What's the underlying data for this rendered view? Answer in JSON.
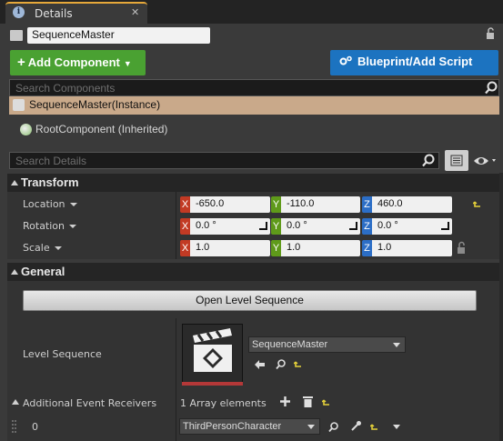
{
  "tab": {
    "title": "Details",
    "close": "✕"
  },
  "actor": {
    "name": "SequenceMaster"
  },
  "toolbar": {
    "add_component_label": "Add Component",
    "blueprint_label": "Blueprint/Add Script"
  },
  "search_components": {
    "placeholder": "Search Components"
  },
  "components": {
    "self": "SequenceMaster(Instance)",
    "root": "RootComponent (Inherited)"
  },
  "search_details": {
    "placeholder": "Search Details"
  },
  "transform": {
    "title": "Transform",
    "location": {
      "label": "Location",
      "x": "-650.0",
      "y": "-110.0",
      "z": "460.0"
    },
    "rotation": {
      "label": "Rotation",
      "x": "0.0 °",
      "y": "0.0 °",
      "z": "0.0 °"
    },
    "scale": {
      "label": "Scale",
      "x": "1.0",
      "y": "1.0",
      "z": "1.0"
    }
  },
  "axes": {
    "x": "X",
    "y": "Y",
    "z": "Z"
  },
  "general": {
    "title": "General",
    "open_button": "Open Level Sequence",
    "level_sequence_label": "Level Sequence",
    "level_sequence_value": "SequenceMaster",
    "receivers_label": "Additional Event Receivers",
    "receivers_count": "1 Array elements",
    "element_index": "0",
    "element_value": "ThirdPersonCharacter"
  },
  "colors": {
    "accent_green": "#4aa132",
    "accent_blue": "#1c73c0",
    "selected_row": "#c9a98a",
    "reset_arrow": "#e6d23a"
  }
}
